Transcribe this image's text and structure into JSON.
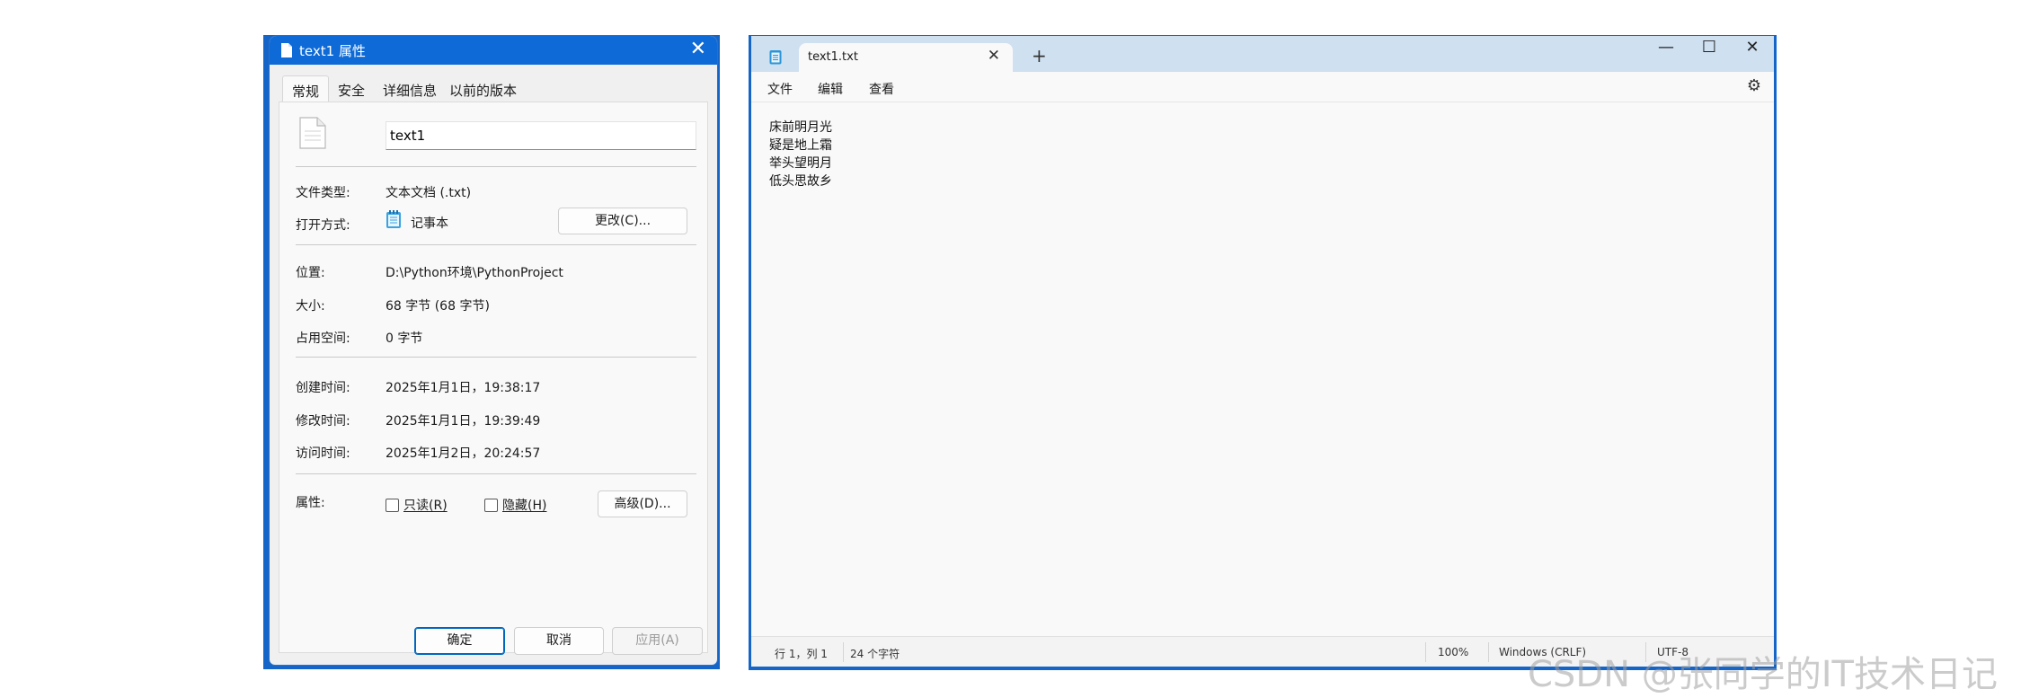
{
  "dialog": {
    "title": "text1 属性",
    "close_glyph": "✕",
    "tabs": [
      {
        "label": "常规",
        "active": true
      },
      {
        "label": "安全",
        "active": false
      },
      {
        "label": "详细信息",
        "active": false
      },
      {
        "label": "以前的版本",
        "active": false
      }
    ],
    "filename_value": "text1",
    "file_type_label": "文件类型:",
    "file_type_value": "文本文档 (.txt)",
    "open_with_label": "打开方式:",
    "open_with_value": "记事本",
    "change_button": "更改(C)...",
    "location_label": "位置:",
    "location_value": "D:\\Python环境\\PythonProject",
    "size_label": "大小:",
    "size_value": "68 字节 (68 字节)",
    "disk_size_label": "占用空间:",
    "disk_size_value": "0 字节",
    "created_label": "创建时间:",
    "created_value": "2025年1月1日，19:38:17",
    "modified_label": "修改时间:",
    "modified_value": "2025年1月1日，19:39:49",
    "accessed_label": "访问时间:",
    "accessed_value": "2025年1月2日，20:24:57",
    "attributes_label": "属性:",
    "readonly_label": "只读(R)",
    "hidden_label": "隐藏(H)",
    "advanced_button": "高级(D)...",
    "ok_button": "确定",
    "cancel_button": "取消",
    "apply_button": "应用(A)"
  },
  "notepad": {
    "tab_title": "text1.txt",
    "tab_close_glyph": "✕",
    "new_tab_glyph": "+",
    "minimize_glyph": "—",
    "maximize_glyph": "☐",
    "close_glyph": "✕",
    "menu": [
      "文件",
      "编辑",
      "查看"
    ],
    "settings_glyph": "⚙",
    "lines": [
      "床前明月光",
      "疑是地上霜",
      "举头望明月",
      "低头思故乡"
    ],
    "status": {
      "position": "行 1，列 1",
      "char_count": "24 个字符",
      "zoom": "100%",
      "line_ending": "Windows (CRLF)",
      "encoding": "UTF-8"
    }
  },
  "watermark": "CSDN @张同学的IT技术日记",
  "colors": {
    "accent": "#0d6ad6",
    "frame": "#1565c8",
    "notepad_titlebar": "#cfe0f1"
  }
}
